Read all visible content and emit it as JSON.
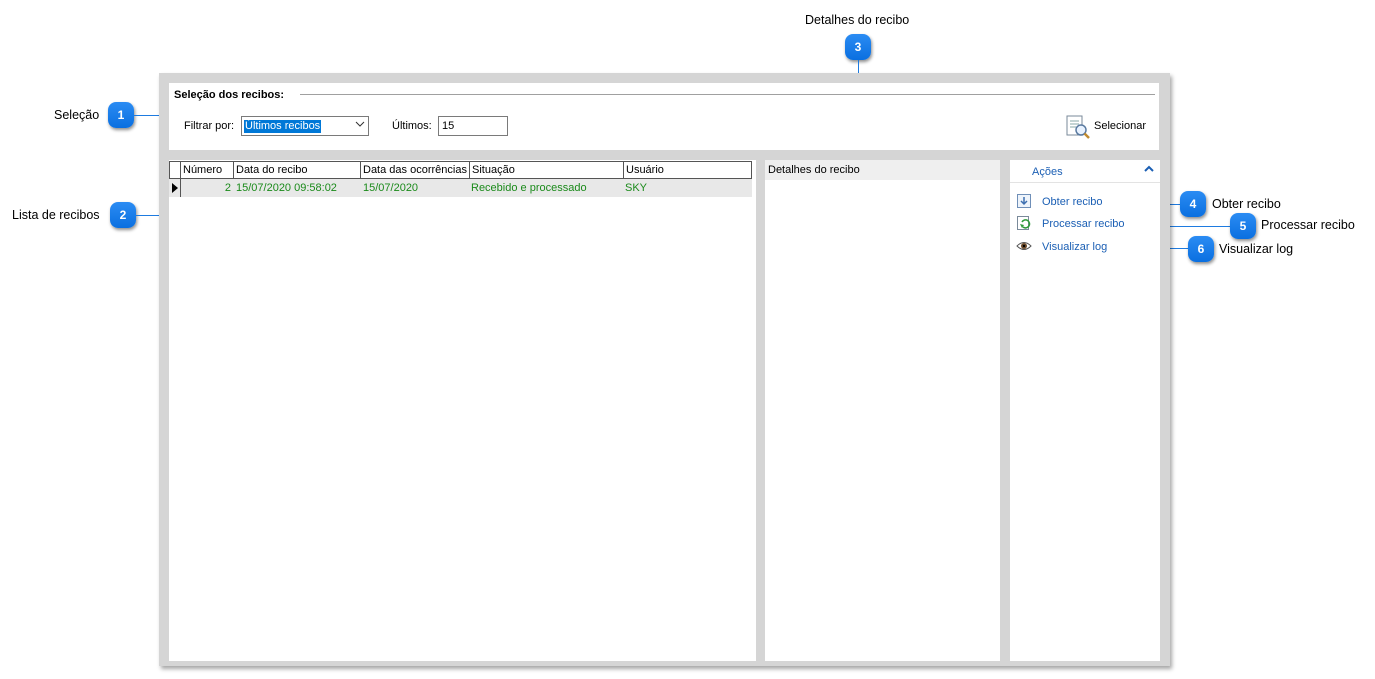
{
  "callouts": [
    {
      "num": "1",
      "label": "Seleção"
    },
    {
      "num": "2",
      "label": "Lista de recibos"
    },
    {
      "num": "3",
      "label": "Detalhes do recibo"
    },
    {
      "num": "4",
      "label": "Obter recibo"
    },
    {
      "num": "5",
      "label": "Processar recibo"
    },
    {
      "num": "6",
      "label": "Visualizar log"
    }
  ],
  "selection": {
    "title": "Seleção dos recibos:",
    "filter_label": "Filtrar por:",
    "filter_value": "Últimos recibos",
    "last_label": "Últimos:",
    "last_value": "15",
    "select_button": "Selecionar"
  },
  "grid": {
    "columns": [
      "Número",
      "Data do recibo",
      "Data das ocorrências",
      "Situação",
      "Usuário"
    ],
    "rows": [
      {
        "numero": "2",
        "data_recibo": "15/07/2020 09:58:02",
        "data_ocorrencias": "15/07/2020",
        "situacao": "Recebido e processado",
        "usuario": "SKY"
      }
    ]
  },
  "details": {
    "header": "Detalhes do recibo"
  },
  "actions": {
    "header": "Ações",
    "items": [
      {
        "label": "Obter recibo",
        "icon": "download-icon"
      },
      {
        "label": "Processar recibo",
        "icon": "process-icon"
      },
      {
        "label": "Visualizar log",
        "icon": "eye-icon"
      }
    ]
  },
  "colors": {
    "accent": "#1b5fb4",
    "row_text": "#1a8a1a",
    "badge": "#0a6fe0"
  }
}
